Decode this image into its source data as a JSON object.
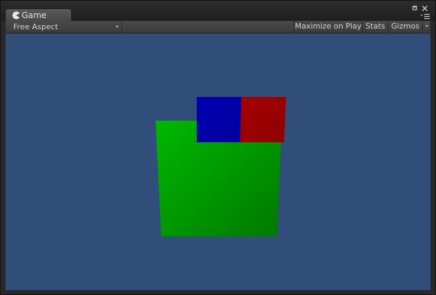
{
  "window": {
    "tab_title": "Game",
    "tab_icon": "pacman-game-icon"
  },
  "controls": {
    "maximize_icon": "maximize-icon",
    "close_icon": "close-icon",
    "menu_icon": "panel-menu-icon"
  },
  "toolbar": {
    "aspect_label": "Free Aspect",
    "maximize_label": "Maximize on Play",
    "stats_label": "Stats",
    "gizmos_label": "Gizmos"
  },
  "scene": {
    "background_color": "#314d79",
    "objects": [
      {
        "name": "green-quad",
        "color": "#00a000"
      },
      {
        "name": "blue-quad",
        "color": "#0000a8"
      },
      {
        "name": "red-quad",
        "color": "#a00000"
      }
    ]
  }
}
